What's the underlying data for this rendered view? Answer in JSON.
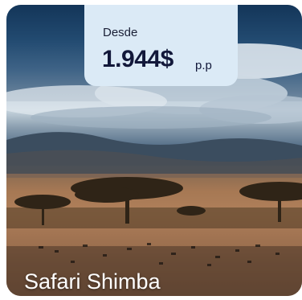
{
  "card": {
    "price_label": "Desde",
    "price_value": "1.944$",
    "price_unit": "p.p",
    "title": "Safari Shimba",
    "image_alt": "safari-savanna-photo"
  },
  "colors": {
    "price_box_bg": "#dbeaf6",
    "text_dark": "#12183a",
    "title_text": "#ffffff"
  }
}
